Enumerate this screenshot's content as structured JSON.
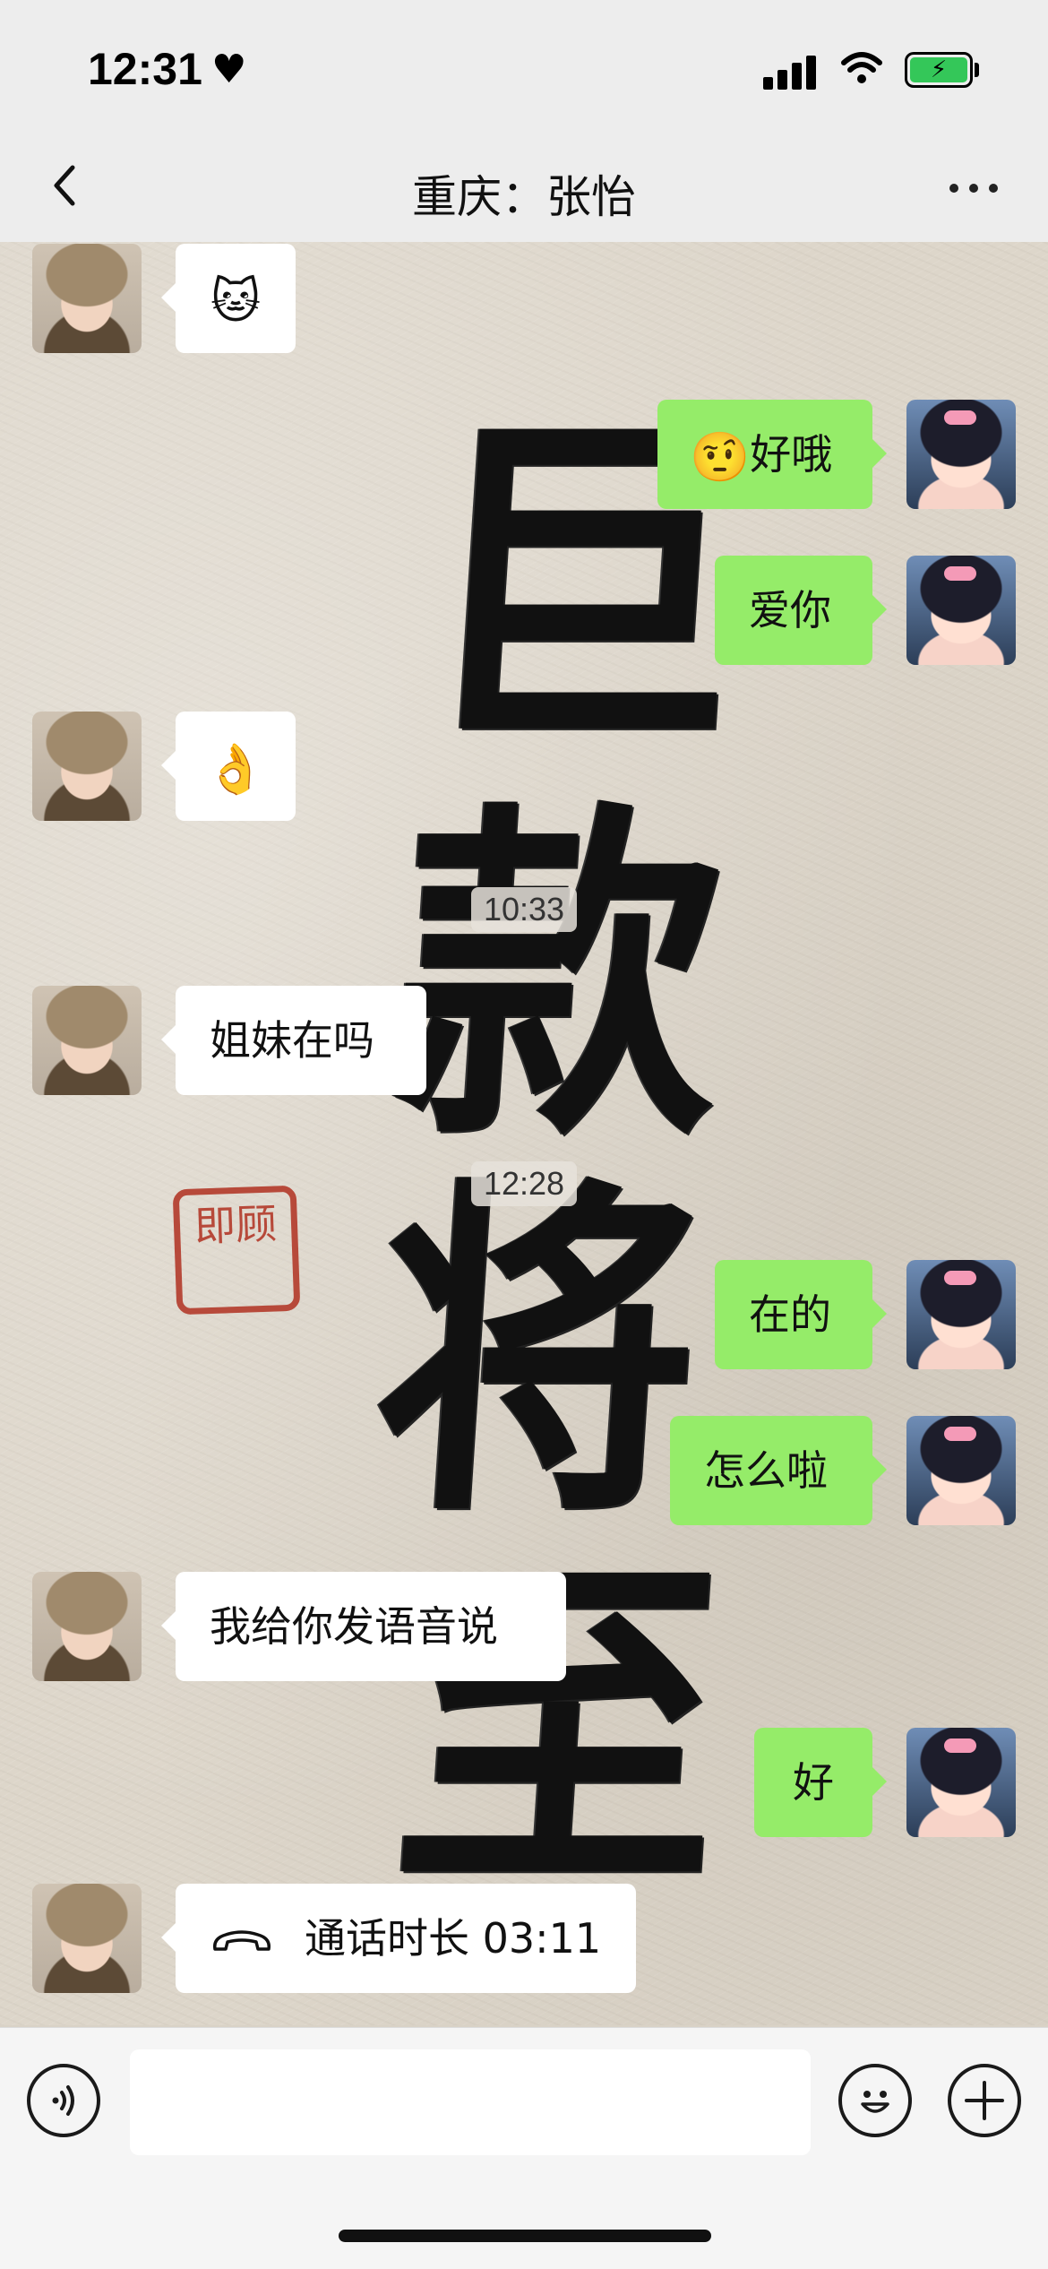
{
  "status_bar": {
    "time": "12:31",
    "heart_icon": "♥",
    "wifi_icon": "wifi-icon",
    "battery": "charging"
  },
  "nav": {
    "title": "重庆：张怡",
    "back_icon": "chevron-left-icon",
    "more_icon": "more-icon"
  },
  "wallpaper": {
    "calligraphy": [
      "巨",
      "款",
      "将",
      "至"
    ],
    "seal_text": "即顾"
  },
  "messages": [
    {
      "side": "in",
      "type": "sticker",
      "content": "🐱"
    },
    {
      "side": "out",
      "type": "text",
      "emoji": "🤨",
      "content": "好哦"
    },
    {
      "side": "out",
      "type": "text",
      "content": "爱你"
    },
    {
      "side": "in",
      "type": "sticker",
      "content": "👌"
    },
    {
      "type": "time",
      "content": "10:33"
    },
    {
      "side": "in",
      "type": "text",
      "content": "姐妹在吗"
    },
    {
      "type": "time",
      "content": "12:28"
    },
    {
      "side": "out",
      "type": "text",
      "content": "在的"
    },
    {
      "side": "out",
      "type": "text",
      "content": "怎么啦"
    },
    {
      "side": "in",
      "type": "text",
      "content": "我给你发语音说"
    },
    {
      "side": "out",
      "type": "text",
      "content": "好"
    },
    {
      "side": "in",
      "type": "call",
      "content": "通话时长 03:11"
    }
  ],
  "input_bar": {
    "voice_icon": "voice-icon",
    "emoji_icon": "emoji-icon",
    "plus_icon": "plus-icon",
    "placeholder": ""
  },
  "colors": {
    "outgoing_bubble": "#95ec69",
    "incoming_bubble": "#ffffff",
    "bar_background": "#ededed",
    "seal": "#b33a2a"
  }
}
